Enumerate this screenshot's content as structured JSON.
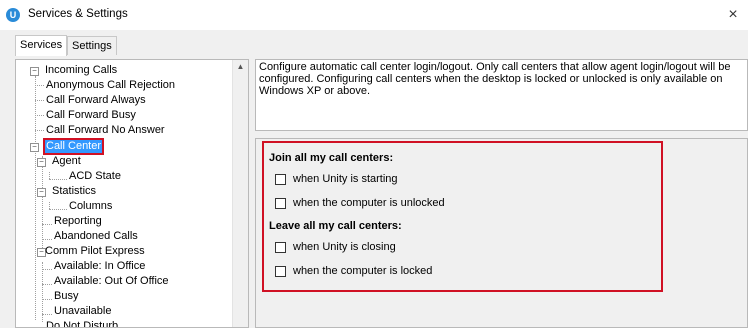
{
  "window": {
    "title": "Services & Settings",
    "app_icon_letter": "U",
    "close_glyph": "×"
  },
  "tabs": [
    {
      "label": "Services",
      "active": true
    },
    {
      "label": "Settings",
      "active": false
    }
  ],
  "tree": {
    "items": [
      {
        "label": "Incoming Calls"
      },
      {
        "label": "Anonymous Call Rejection"
      },
      {
        "label": "Call Forward Always"
      },
      {
        "label": "Call Forward Busy"
      },
      {
        "label": "Call Forward No Answer"
      },
      {
        "label": "Call Center",
        "selected": true
      },
      {
        "label": "Agent"
      },
      {
        "label": "ACD State"
      },
      {
        "label": "Statistics"
      },
      {
        "label": "Columns"
      },
      {
        "label": "Reporting"
      },
      {
        "label": "Abandoned Calls"
      },
      {
        "label": "Comm Pilot Express"
      },
      {
        "label": "Available: In Office"
      },
      {
        "label": "Available: Out Of Office"
      },
      {
        "label": "Busy"
      },
      {
        "label": "Unavailable"
      },
      {
        "label": "Do Not Disturb"
      }
    ],
    "expander_glyph": "−",
    "scroll_up_glyph": "▲"
  },
  "description": "Configure automatic call center login/logout.  Only call centers that allow agent login/logout will be configured.  Configuring call centers when the desktop is locked or unlocked is only available on Windows XP or above.",
  "options": {
    "join_heading": "Join all my call centers:",
    "join_items": [
      {
        "label": "when Unity is starting",
        "checked": false
      },
      {
        "label": "when the computer is unlocked",
        "checked": false
      }
    ],
    "leave_heading": "Leave all my call centers:",
    "leave_items": [
      {
        "label": "when Unity is closing",
        "checked": false
      },
      {
        "label": "when the computer is locked",
        "checked": false
      }
    ]
  },
  "colors": {
    "highlight": "#d01124",
    "selection": "#3399ff",
    "app_icon": "#2a8bd8"
  }
}
